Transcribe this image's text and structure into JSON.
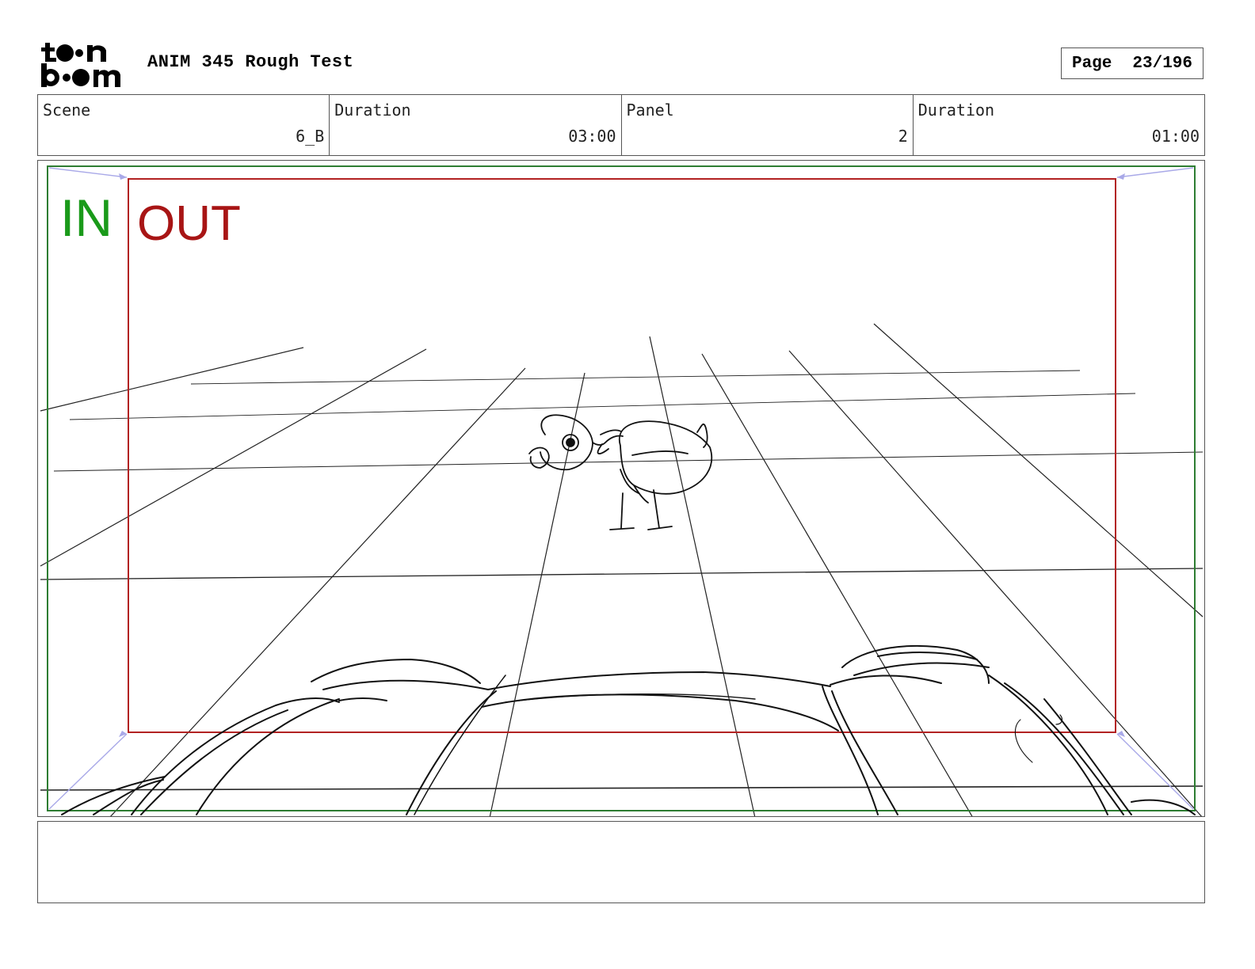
{
  "header": {
    "logo_lines": [
      "toon",
      "boom"
    ],
    "project_title": "ANIM 345 Rough Test",
    "page_label": "Page",
    "page_number": "23/196"
  },
  "info": [
    {
      "label": "Scene",
      "value": "6_B"
    },
    {
      "label": "Duration",
      "value": "03:00"
    },
    {
      "label": "Panel",
      "value": "2"
    },
    {
      "label": "Duration",
      "value": "01:00"
    }
  ],
  "panel": {
    "in_label": "IN",
    "out_label": "OUT",
    "colors": {
      "in": "#1a9a1a",
      "out": "#a81515",
      "in_frame": "#2e7d32",
      "out_frame": "#b22222"
    }
  },
  "notes": {
    "text": ""
  }
}
